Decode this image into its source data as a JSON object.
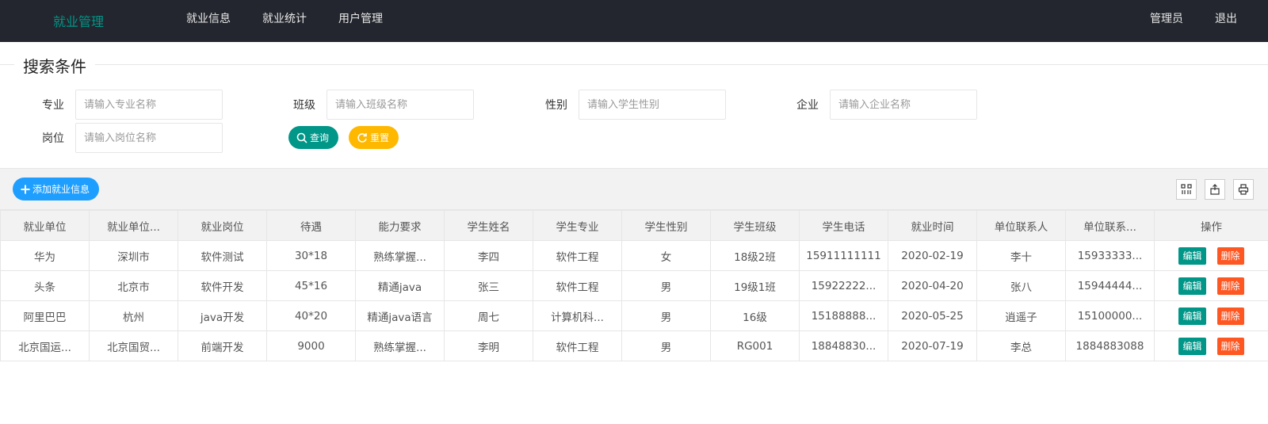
{
  "header": {
    "logo": "就业管理",
    "nav": [
      "就业信息",
      "就业统计",
      "用户管理"
    ],
    "right": [
      "管理员",
      "退出"
    ]
  },
  "search": {
    "legend": "搜索条件",
    "fields": [
      {
        "label": "专业",
        "placeholder": "请输入专业名称"
      },
      {
        "label": "班级",
        "placeholder": "请输入班级名称"
      },
      {
        "label": "性别",
        "placeholder": "请输入学生性别"
      },
      {
        "label": "企业",
        "placeholder": "请输入企业名称"
      },
      {
        "label": "岗位",
        "placeholder": "请输入岗位名称"
      }
    ],
    "query_label": "查询",
    "reset_label": "重置"
  },
  "toolbar": {
    "add_label": "添加就业信息",
    "icons": [
      "columns-icon",
      "export-icon",
      "print-icon"
    ]
  },
  "table": {
    "columns": [
      "就业单位",
      "就业单位...",
      "就业岗位",
      "待遇",
      "能力要求",
      "学生姓名",
      "学生专业",
      "学生性别",
      "学生班级",
      "学生电话",
      "就业时间",
      "单位联系人",
      "单位联系...",
      "操作"
    ],
    "rows": [
      [
        "华为",
        "深圳市",
        "软件测试",
        "30*18",
        "熟练掌握...",
        "李四",
        "软件工程",
        "女",
        "18级2班",
        "15911111111",
        "2020-02-19",
        "李十",
        "15933333..."
      ],
      [
        "头条",
        "北京市",
        "软件开发",
        "45*16",
        "精通java",
        "张三",
        "软件工程",
        "男",
        "19级1班",
        "15922222...",
        "2020-04-20",
        "张八",
        "15944444..."
      ],
      [
        "阿里巴巴",
        "杭州",
        "java开发",
        "40*20",
        "精通java语言",
        "周七",
        "计算机科...",
        "男",
        "16级",
        "15188888...",
        "2020-05-25",
        "逍遥子",
        "15100000..."
      ],
      [
        "北京国运...",
        "北京国贸...",
        "前端开发",
        "9000",
        "熟练掌握...",
        "李明",
        "软件工程",
        "男",
        "RG001",
        "18848830...",
        "2020-07-19",
        "李总",
        "1884883088"
      ]
    ],
    "edit_label": "编辑",
    "delete_label": "删除"
  },
  "colors": {
    "topbar": "#23262e",
    "accent": "#009688",
    "warning": "#ffb800",
    "primary": "#1e9fff",
    "danger": "#ff5722"
  }
}
